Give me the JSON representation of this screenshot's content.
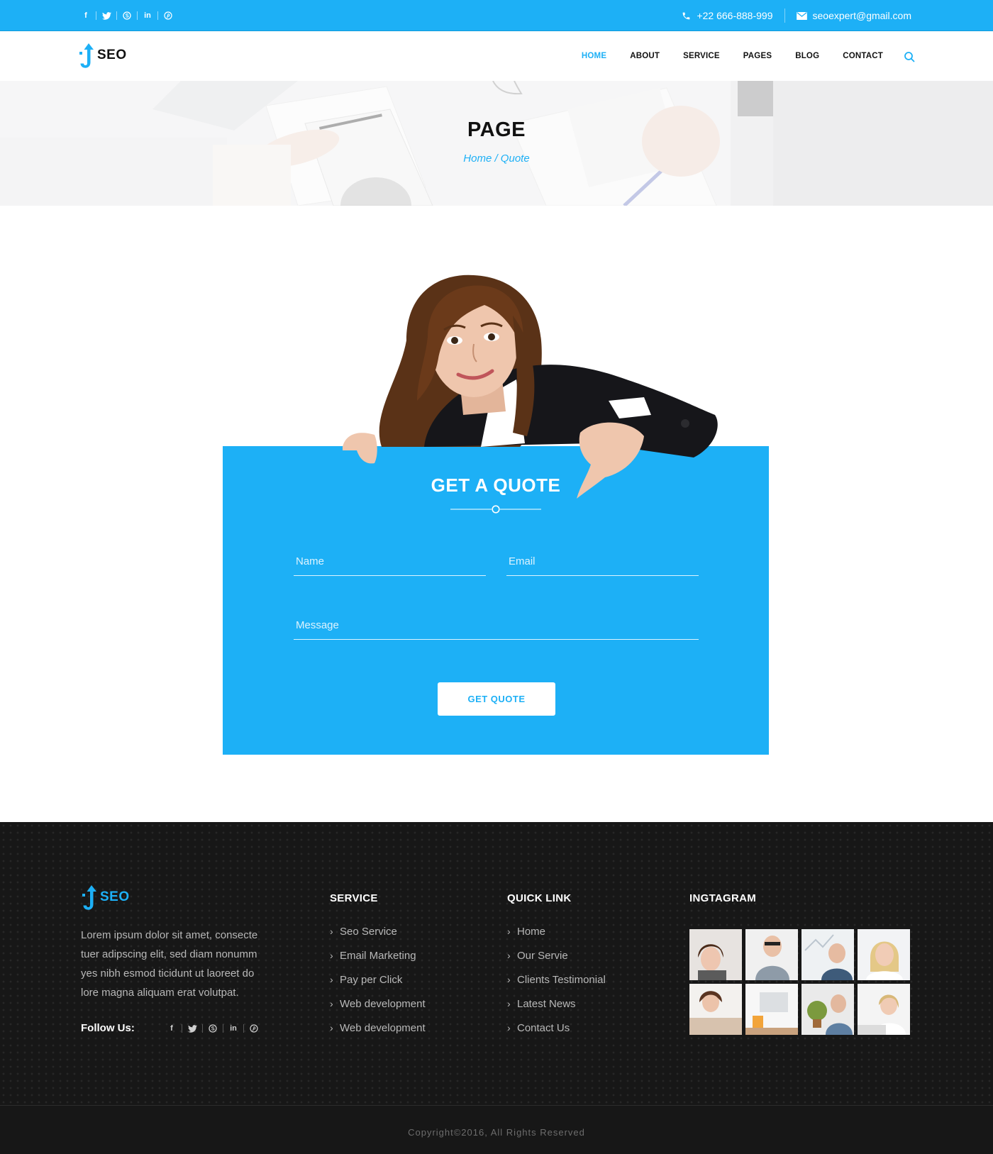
{
  "topbar": {
    "socials": [
      "facebook-icon",
      "twitter-icon",
      "skype-icon",
      "linkedin-icon",
      "pinterest-icon"
    ],
    "phone": "+22 666-888-999",
    "email": "seoexpert@gmail.com"
  },
  "brand": {
    "name": "SEO",
    "accent": "#1db0f6"
  },
  "nav": {
    "items": [
      {
        "label": "HOME",
        "active": true
      },
      {
        "label": "ABOUT",
        "active": false
      },
      {
        "label": "SERVICE",
        "active": false
      },
      {
        "label": "PAGES",
        "active": false
      },
      {
        "label": "BLOG",
        "active": false
      },
      {
        "label": "CONTACT",
        "active": false
      }
    ]
  },
  "hero": {
    "title": "PAGE",
    "breadcrumb": "Home / Quote"
  },
  "quote": {
    "title": "GET A QUOTE",
    "name_placeholder": "Name",
    "email_placeholder": "Email",
    "message_placeholder": "Message",
    "button_label": "GET QUOTE"
  },
  "footer": {
    "about": "Lorem ipsum dolor sit amet, consecte tuer adipscing elit, sed diam nonumm yes nibh esmod ticidunt ut laoreet do lore magna aliquam erat volutpat.",
    "follow_label": "Follow Us:",
    "service": {
      "title": "SERVICE",
      "items": [
        "Seo Service",
        "Email Marketing",
        "Pay per Click",
        "Web development",
        "Web development"
      ]
    },
    "quick_link": {
      "title": "QUICK LINK",
      "items": [
        "Home",
        "Our Servie",
        "Clients Testimonial",
        "Latest News",
        "Contact Us"
      ]
    },
    "instagram": {
      "title": "INGTAGRAM"
    },
    "copyright": "Copyright©2016, All Rights Reserved"
  }
}
